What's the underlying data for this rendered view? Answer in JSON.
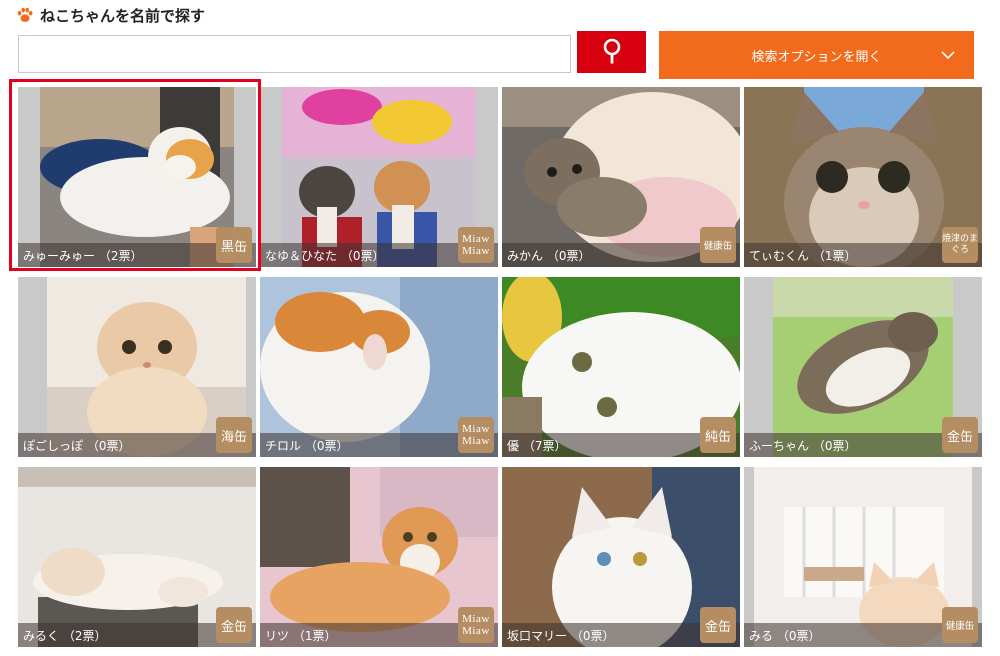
{
  "page": {
    "title": "ねこちゃんを名前で探す",
    "search_value": "",
    "options_label": "検索オプションを開く"
  },
  "colors": {
    "search_button": "#d7000f",
    "options_button": "#f26b1d",
    "badge": "#b58d62",
    "highlight": "#e5001e"
  },
  "cats": [
    {
      "name": "みゅーみゅー （2票）",
      "badge": "黒缶",
      "selected": true
    },
    {
      "name": "なゆ＆ひなた （0票）",
      "badge": "Miaw Miaw"
    },
    {
      "name": "みかん （0票）",
      "badge": "健康缶"
    },
    {
      "name": "てぃむくん （1票）",
      "badge": "焼津のまぐろ"
    },
    {
      "name": "ぽごしっぽ （0票）",
      "badge": "海缶"
    },
    {
      "name": "チロル （0票）",
      "badge": "Miaw Miaw"
    },
    {
      "name": "優 （7票）",
      "badge": "純缶"
    },
    {
      "name": "ふーちゃん （0票）",
      "badge": "金缶"
    },
    {
      "name": "みるく （2票）",
      "badge": "金缶"
    },
    {
      "name": "リツ （1票）",
      "badge": "Miaw Miaw"
    },
    {
      "name": "坂口マリー （0票）",
      "badge": "金缶"
    },
    {
      "name": "みる （0票）",
      "badge": "健康缶"
    }
  ]
}
